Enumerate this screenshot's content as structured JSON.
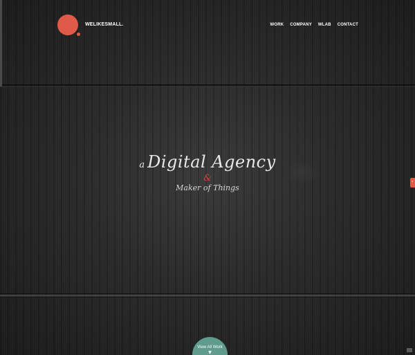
{
  "header": {
    "logo_text": "WELIKESMALL.",
    "nav": [
      "WORK",
      "COMPANY",
      "WLAB",
      "CONTACT"
    ]
  },
  "hero": {
    "prefix": "a",
    "headline": "Digital Agency",
    "ampersand": "&",
    "subline": "Maker of Things"
  },
  "side_tab": {
    "icon": "chevron-left-icon",
    "glyph": "‹"
  },
  "cta": {
    "label": "View All Work",
    "icon": "chevron-down-icon",
    "glyph": "▼"
  },
  "colors": {
    "brand": "#e05a48",
    "cta": "#5f9c8d",
    "background": "#2a2a2a"
  }
}
